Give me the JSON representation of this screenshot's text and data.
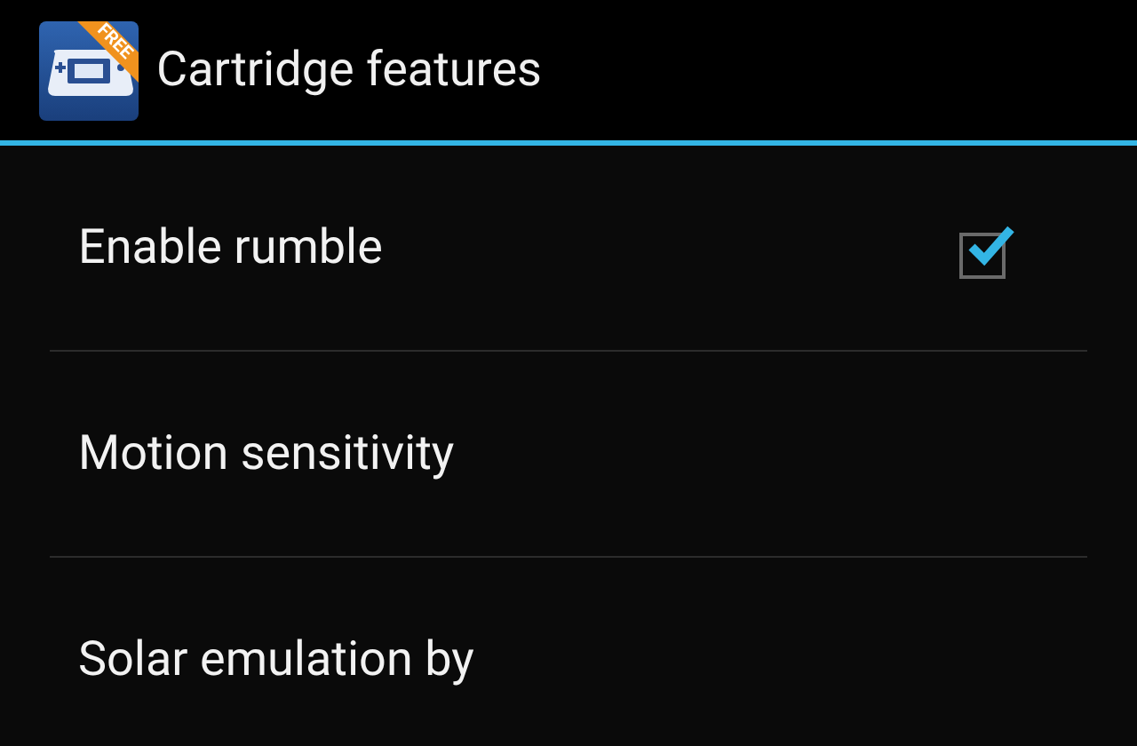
{
  "action_bar": {
    "title": "Cartridge features",
    "app_icon": {
      "badge": "FREE"
    }
  },
  "preferences": [
    {
      "kind": "checkbox",
      "label": "Enable rumble",
      "checked": true
    },
    {
      "kind": "plain",
      "label": "Motion sensitivity"
    },
    {
      "kind": "plain",
      "label": "Solar emulation by"
    }
  ]
}
